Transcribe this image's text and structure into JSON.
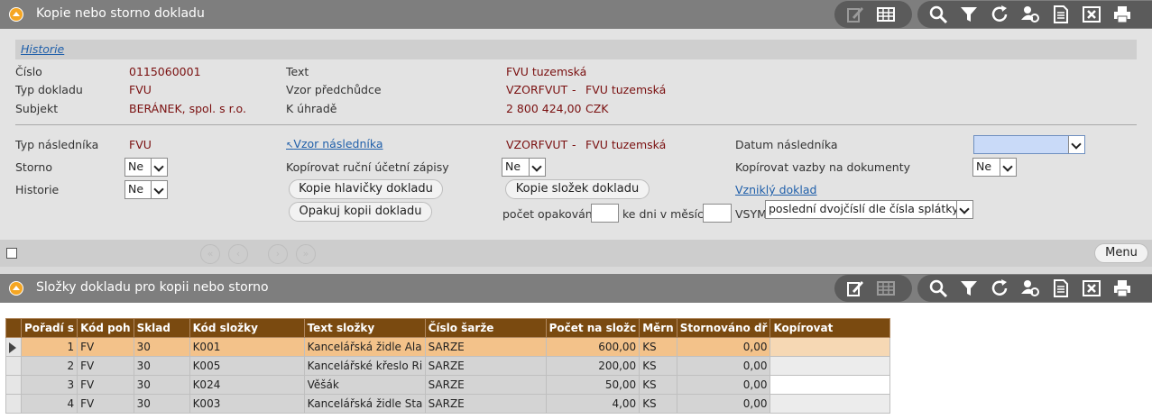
{
  "top_panel": {
    "title": "Kopie nebo storno dokladu",
    "history_link": "Historie",
    "header": {
      "cislo_label": "Číslo",
      "cislo_value": "0115060001",
      "typ_dokladu_label": "Typ dokladu",
      "typ_dokladu_value": "FVU",
      "subjekt_label": "Subjekt",
      "subjekt_value": "BERÁNEK, spol. s r.o.",
      "text_label": "Text",
      "text_value": "FVU tuzemská",
      "vzor_predchudce_label": "Vzor předchůdce",
      "vzor_predchudce_code": "VZORFVUT",
      "vzor_predchudce_dash": "-",
      "vzor_predchudce_name": "FVU tuzemská",
      "k_uhrade_label": "K úhradě",
      "k_uhrade_value": "2 800 424,00",
      "k_uhrade_currency": "CZK"
    },
    "form": {
      "typ_naslednika_label": "Typ následníka",
      "typ_naslednika_value": "FVU",
      "vzor_naslednika_link": "Vzor následníka",
      "vzor_naslednika_code": "VZORFVUT",
      "vzor_naslednika_dash": "-",
      "vzor_naslednika_name": "FVU tuzemská",
      "datum_naslednika_label": "Datum následníka",
      "datum_naslednika_value": "",
      "storno_label": "Storno",
      "storno_value": "Ne",
      "kopirovat_zapisy_label": "Kopírovat ruční účetní zápisy",
      "kopirovat_zapisy_value": "Ne",
      "kopirovat_vazby_label": "Kopírovat vazby na dokumenty",
      "kopirovat_vazby_value": "Ne",
      "historie_label": "Historie",
      "historie_value": "Ne",
      "btn_kopie_hlavicky": "Kopie hlavičky dokladu",
      "btn_kopie_slozek": "Kopie složek dokladu",
      "btn_opakuj_kopii": "Opakuj kopii dokladu",
      "vznikly_doklad_link": "Vzniklý doklad",
      "pocet_opakovani_label": "počet opakování",
      "pocet_opakovani_value": "",
      "ke_dni_label": "ke dni v měsíci",
      "ke_dni_value": "",
      "vsym_label": "VSYM",
      "vsym_value": "poslední dvojčíslí dle čísla splátky"
    }
  },
  "navbar": {
    "menu_label": "Menu"
  },
  "bottom_panel": {
    "title": "Složky dokladu pro kopii nebo storno",
    "columns": [
      "Pořadí s",
      "Kód poh",
      "Sklad",
      "Kód složky",
      "Text složky",
      "Číslo šarže",
      "Počet na složc",
      "Měrn",
      "Stornováno dř",
      "Kopírovat"
    ],
    "rows": [
      [
        "1",
        "FV",
        "30",
        "K001",
        "Kancelářská židle Alab",
        "SARZE",
        "600,00",
        "KS",
        "0,00",
        ""
      ],
      [
        "2",
        "FV",
        "30",
        "K005",
        "Kancelářské křeslo Rio",
        "SARZE",
        "200,00",
        "KS",
        "0,00",
        ""
      ],
      [
        "3",
        "FV",
        "30",
        "K024",
        "Věšák",
        "SARZE",
        "50,00",
        "KS",
        "0,00",
        ""
      ],
      [
        "4",
        "FV",
        "30",
        "K003",
        "Kancelářská židle Stand",
        "SARZE",
        "4,00",
        "KS",
        "0,00",
        ""
      ]
    ]
  }
}
